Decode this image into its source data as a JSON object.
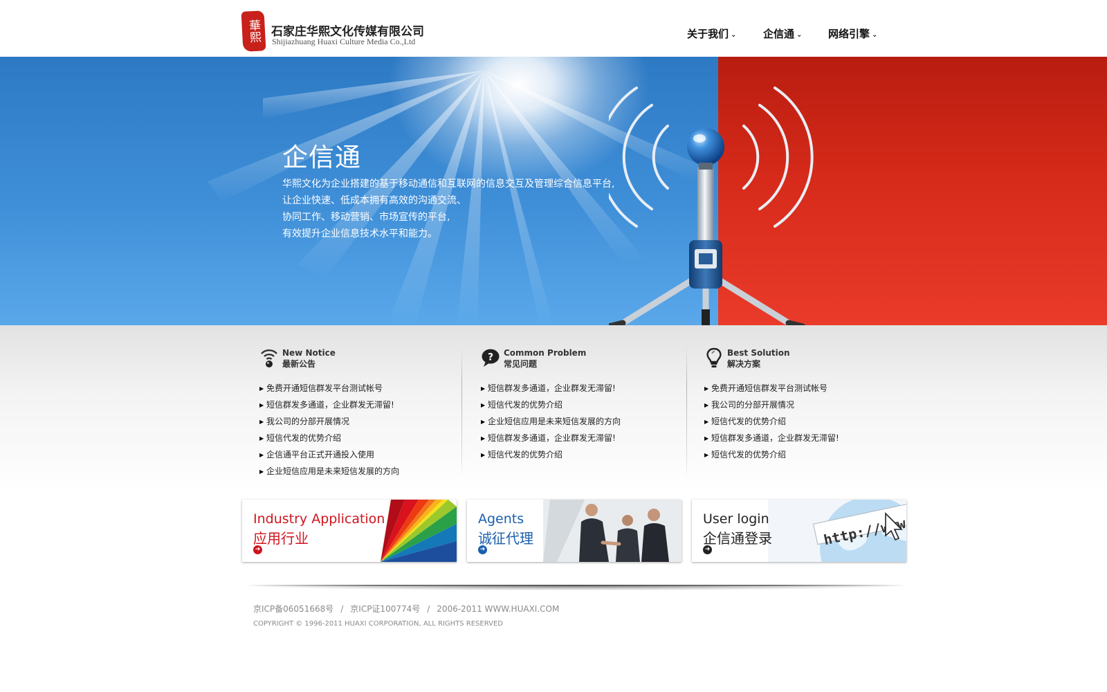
{
  "header": {
    "logo_seal": "華熙",
    "company_cn": "石家庄华熙文化传媒有限公司",
    "company_en": "Shijiazhuang Huaxi Culture Media Co.,Ltd",
    "nav": [
      {
        "label": "关于我们",
        "icon": "chevron-down-icon"
      },
      {
        "label": "企信通",
        "icon": "chevron-down-icon"
      },
      {
        "label": "网络引擎",
        "icon": "chevron-down-icon"
      }
    ]
  },
  "banner": {
    "title": "企信通",
    "lines": [
      "华熙文化为企业搭建的基于移动通信和互联网的信息交互及管理综合信息平台,",
      "让企业快速、低成本拥有高效的沟通交流、",
      "协同工作、移动营销、市场宣传的平台,",
      "有效提升企业信息技术水平和能力。"
    ],
    "colors": {
      "blue": "#3f8fd8",
      "red": "#d62a1a"
    }
  },
  "columns": [
    {
      "en": "New Notice",
      "cn": "最新公告",
      "icon": "signal-icon",
      "items": [
        "免费开通短信群发平台测试帐号",
        "短信群发多通道，企业群发无滞留!",
        "我公司的分部开展情况",
        "短信代发的优势介绍",
        "企信通平台正式开通投入使用",
        "企业短信应用是未来短信发展的方向"
      ]
    },
    {
      "en": "Common Problem",
      "cn": "常见问题",
      "icon": "question-bubble-icon",
      "items": [
        "短信群发多通道，企业群发无滞留!",
        "短信代发的优势介绍",
        "企业短信应用是未来短信发展的方向",
        "短信群发多通道，企业群发无滞留!",
        "短信代发的优势介绍"
      ]
    },
    {
      "en": "Best Solution",
      "cn": "解决方案",
      "icon": "lightbulb-icon",
      "items": [
        "免费开通短信群发平台测试帐号",
        "我公司的分部开展情况",
        "短信代发的优势介绍",
        "短信群发多通道，企业群发无滞留!",
        "短信代发的优势介绍"
      ]
    }
  ],
  "cards": [
    {
      "en": "Industry Application",
      "cn": "应用行业",
      "color": "#d0141e",
      "icon": "arrow-right-circle-icon"
    },
    {
      "en": "Agents",
      "cn": "诚征代理",
      "color": "#1a5fae",
      "icon": "arrow-right-circle-icon"
    },
    {
      "en": "User login",
      "cn": "企信通登录",
      "color": "#222222",
      "icon": "arrow-right-circle-icon",
      "url_text": "http://www."
    }
  ],
  "footer": {
    "icp1": "京ICP备06051668号",
    "icp2": "京ICP证100774号",
    "years_site": "2006-2011 WWW.HUAXI.COM",
    "separator": "/",
    "copyright": "COPYRIGHT © 1996-2011 HUAXI CORPORATION, ALL RIGHTS RESERVED"
  }
}
